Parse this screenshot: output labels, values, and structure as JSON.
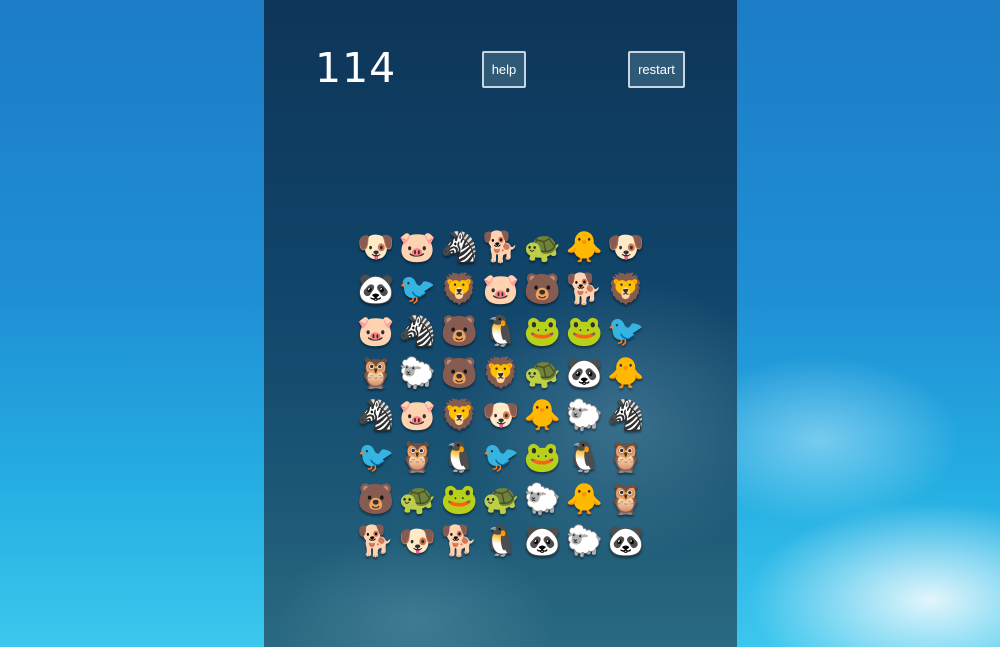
{
  "score": "114",
  "buttons": {
    "help": "help",
    "restart": "restart"
  },
  "animal_styles": {
    "dog-brown": {
      "glyph": "🐶",
      "color": "#8b3a1f"
    },
    "pig": {
      "glyph": "🐷",
      "color": "#f28ab2"
    },
    "zebra": {
      "glyph": "🦓",
      "color": "#e6e6e6"
    },
    "puppy": {
      "glyph": "🐕",
      "color": "#e8c98c"
    },
    "turtle": {
      "glyph": "🐢",
      "color": "#5fbf2a"
    },
    "chick": {
      "glyph": "🐥",
      "color": "#f5d020"
    },
    "panda": {
      "glyph": "🐼",
      "color": "#f2f2f2"
    },
    "bird": {
      "glyph": "🐦",
      "color": "#aab6c4"
    },
    "lion": {
      "glyph": "🦁",
      "color": "#c8841a"
    },
    "bear": {
      "glyph": "🐻",
      "color": "#8a3d22"
    },
    "penguin": {
      "glyph": "🐧",
      "color": "#222222"
    },
    "frog": {
      "glyph": "🐸",
      "color": "#2ebd3a"
    },
    "owl": {
      "glyph": "🦉",
      "color": "#8f5a22"
    },
    "sheep": {
      "glyph": "🐑",
      "color": "#f0e8ea"
    }
  },
  "board": [
    [
      "dog-brown",
      "pig",
      "zebra",
      "puppy",
      "turtle",
      "chick",
      "dog-brown"
    ],
    [
      "panda",
      "bird",
      "lion",
      "pig",
      "bear",
      "puppy",
      "lion"
    ],
    [
      "pig",
      "zebra",
      "bear",
      "penguin",
      "frog",
      "frog",
      "bird"
    ],
    [
      "owl",
      "sheep",
      "bear",
      "lion",
      "turtle",
      "panda",
      "chick"
    ],
    [
      "zebra",
      "pig",
      "lion",
      "dog-brown",
      "chick",
      "sheep",
      "zebra"
    ],
    [
      "bird",
      "owl",
      "penguin",
      "bird",
      "frog",
      "penguin",
      "owl"
    ],
    [
      "bear",
      "turtle",
      "frog",
      "turtle",
      "sheep",
      "chick",
      "owl"
    ],
    [
      "puppy",
      "dog-brown",
      "puppy",
      "penguin",
      "panda",
      "sheep",
      "panda"
    ]
  ]
}
